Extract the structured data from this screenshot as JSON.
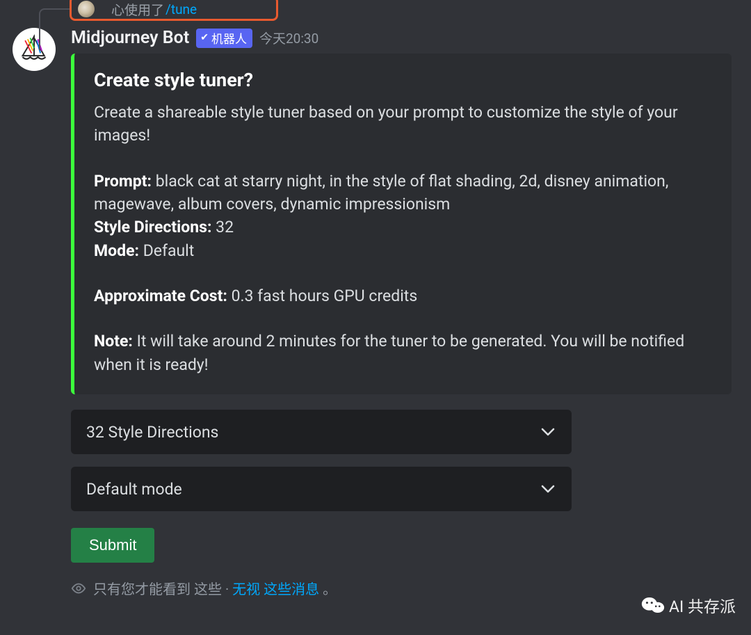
{
  "reply": {
    "used_text": "心使用了",
    "command": "/tune"
  },
  "bot": {
    "name": "Midjourney Bot",
    "tag_label": "机器人",
    "timestamp": "今天20:30"
  },
  "embed": {
    "title": "Create style tuner?",
    "intro": "Create a shareable style tuner based on your prompt to customize the style of your images!",
    "prompt_label": "Prompt:",
    "prompt_value": "black cat at starry night, in the style of flat shading, 2d, disney animation, magewave, album covers, dynamic impressionism",
    "style_dir_label": "Style Directions:",
    "style_dir_value": "32",
    "mode_label": "Mode:",
    "mode_value": "Default",
    "cost_label": "Approximate Cost:",
    "cost_value": "0.3 fast hours GPU credits",
    "note_label": "Note:",
    "note_value": "It will take around 2 minutes for the tuner to be generated. You will be notified when it is ready!"
  },
  "selects": {
    "style_directions": "32 Style Directions",
    "mode": "Default mode"
  },
  "buttons": {
    "submit": "Submit"
  },
  "ephemeral": {
    "only_you": "只有您才能看到 这些",
    "separator": "·",
    "dismiss": "无视 这些消息",
    "period": "。"
  },
  "watermark": {
    "text": "AI 共存派"
  }
}
